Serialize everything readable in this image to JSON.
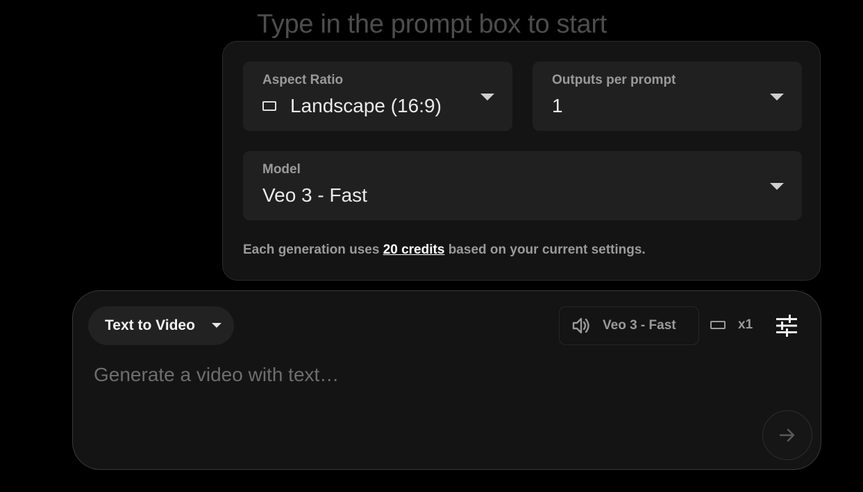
{
  "headline": "Type in the prompt box to start",
  "settings": {
    "aspect_ratio": {
      "label": "Aspect Ratio",
      "value": "Landscape (16:9)"
    },
    "outputs": {
      "label": "Outputs per prompt",
      "value": "1"
    },
    "model": {
      "label": "Model",
      "value": "Veo 3 - Fast"
    },
    "credits_note": {
      "prefix": "Each generation uses ",
      "link": "20 credits",
      "suffix": " based on your current settings."
    }
  },
  "prompt": {
    "mode_label": "Text to Video",
    "model_chip": "Veo 3 - Fast",
    "output_count": "x1",
    "placeholder": "Generate a video with text…",
    "value": ""
  },
  "icons": {
    "ratio": "landscape-ratio-icon",
    "audio": "volume-icon",
    "tune": "tune-icon",
    "send": "arrow-right-icon"
  }
}
